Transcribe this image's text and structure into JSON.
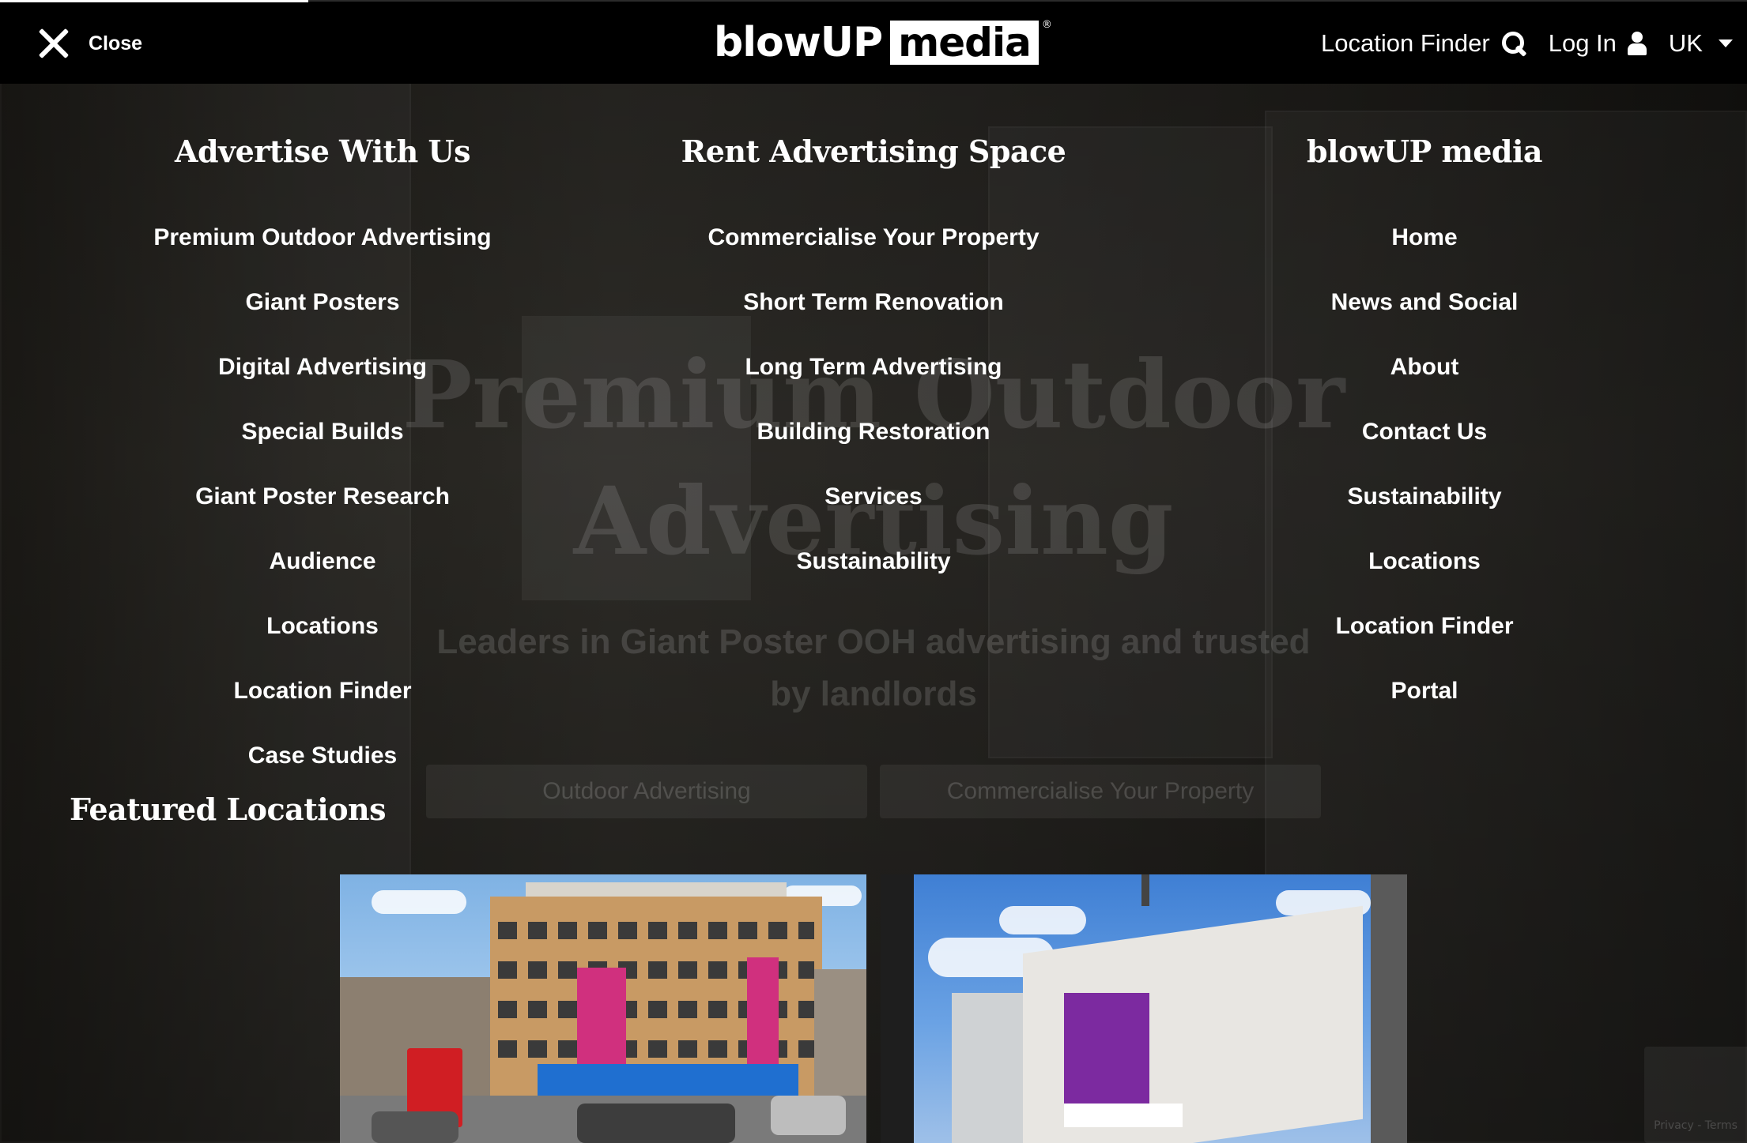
{
  "header": {
    "close_label": "Close",
    "logo_word1": "blowUP",
    "logo_word2": "media",
    "logo_mark": "®",
    "location_finder": "Location Finder",
    "log_in": "Log In",
    "region": "UK",
    "icons": [
      "close-icon",
      "search-icon",
      "user-icon",
      "chevron-down-icon"
    ]
  },
  "menu": {
    "columns": [
      {
        "title": "Advertise With Us",
        "items": [
          "Premium Outdoor Advertising",
          "Giant Posters",
          "Digital Advertising",
          "Special Builds",
          "Giant Poster Research",
          "Audience",
          "Locations",
          "Location Finder",
          "Case Studies"
        ]
      },
      {
        "title": "Rent Advertising Space",
        "items": [
          "Commercialise Your Property",
          "Short Term Renovation",
          "Long Term Advertising",
          "Building Restoration",
          "Services",
          "Sustainability"
        ]
      },
      {
        "title": "blowUP media",
        "items": [
          "Home",
          "News and Social",
          "About",
          "Contact Us",
          "Sustainability",
          "Locations",
          "Location Finder",
          "Portal"
        ]
      }
    ],
    "featured_title": "Featured Locations"
  },
  "background": {
    "hero_title_line1": "Premium Outdoor",
    "hero_title_line2": "Advertising",
    "hero_subtitle_line1": "Leaders in Giant Poster OOH advertising and trusted",
    "hero_subtitle_line2": "by landlords",
    "btn_outdoor": "Outdoor Advertising",
    "btn_commercialise": "Commercialise Your Property",
    "recaptcha": "Privacy - Terms"
  },
  "colors": {
    "header_bg": "#000000",
    "text": "#ffffff",
    "overlay": "#0b0b0b"
  }
}
